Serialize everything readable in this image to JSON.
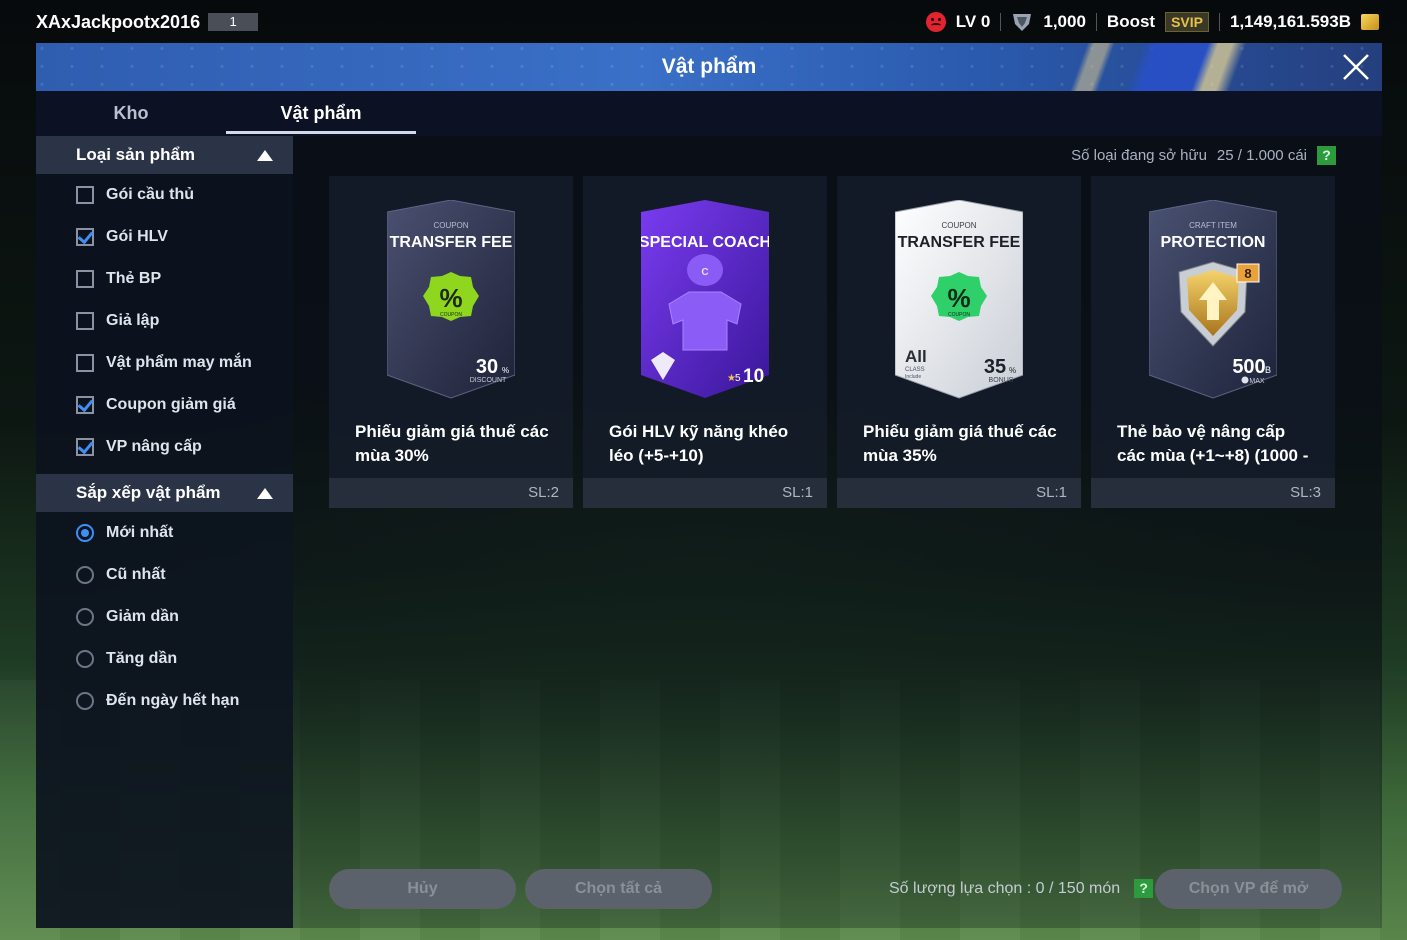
{
  "user": {
    "name": "XAxJackpootx2016",
    "level_box": "1"
  },
  "status": {
    "lv": "LV 0",
    "shield_count": "1,000",
    "boost_label": "Boost",
    "svip_label": "SVIP",
    "balance": "1,149,161.593B"
  },
  "modal": {
    "title": "Vật phẩm"
  },
  "tabs": [
    {
      "label": "Kho"
    },
    {
      "label": "Vật phẩm"
    }
  ],
  "sidebar": {
    "filter_title": "Loại sản phẩm",
    "filters": [
      {
        "label": "Gói cầu thủ",
        "checked": false
      },
      {
        "label": "Gói HLV",
        "checked": true
      },
      {
        "label": "Thẻ BP",
        "checked": false
      },
      {
        "label": "Giả lập",
        "checked": false
      },
      {
        "label": "Vật phẩm may mắn",
        "checked": false
      },
      {
        "label": "Coupon giảm giá",
        "checked": true
      },
      {
        "label": "VP nâng cấp",
        "checked": true
      }
    ],
    "sort_title": "Sắp xếp vật phẩm",
    "sorts": [
      {
        "label": "Mới nhất",
        "selected": true
      },
      {
        "label": "Cũ nhất",
        "selected": false
      },
      {
        "label": "Giảm dần",
        "selected": false
      },
      {
        "label": "Tăng dần",
        "selected": false
      },
      {
        "label": "Đến ngày hết hạn",
        "selected": false
      }
    ]
  },
  "owned": {
    "label": "Số loại đang sở hữu",
    "value": "25 / 1.000 cái"
  },
  "cards": [
    {
      "name": "Phiếu giảm giá thuế các mùa 30%",
      "qty": "SL:2",
      "art": {
        "kind": "coupon-dark",
        "top": "COUPON",
        "title": "TRANSFER FEE",
        "badge": "%",
        "badge_sub": "COUPON",
        "big": "30",
        "unit": "%",
        "sub": "DISCOUNT"
      }
    },
    {
      "name": "Gói HLV kỹ năng khéo léo (+5-+10)",
      "qty": "SL:1",
      "art": {
        "kind": "coach",
        "title": "SPECIAL COACH",
        "jersey": "C",
        "star_small": "5",
        "range": "10"
      }
    },
    {
      "name": "Phiếu giảm giá thuế các mùa 35%",
      "qty": "SL:1",
      "art": {
        "kind": "coupon-light",
        "top": "COUPON",
        "title": "TRANSFER FEE",
        "badge": "%",
        "badge_sub": "COUPON",
        "all": "All",
        "class": "CLASS",
        "include": "Include",
        "big": "35",
        "unit": "%",
        "sub": "BONUS"
      }
    },
    {
      "name": "Thẻ bảo vệ nâng cấp các mùa (+1~+8) (1000 -",
      "qty": "SL:3",
      "art": {
        "kind": "protection",
        "top": "CRAFT ITEM",
        "title": "PROTECTION",
        "level": "8",
        "big": "500",
        "unit": "B",
        "sub": "MAX"
      }
    }
  ],
  "footer": {
    "cancel": "Hủy",
    "select_all": "Chọn tất cả",
    "selection_label": "Số lượng lựa chọn : 0 / 150 món",
    "help": "?",
    "open": "Chọn VP để mở"
  },
  "colors": {
    "accent_blue": "#3d8ff5",
    "help_green": "#2e9a3e",
    "svip_gold": "#e7c14a",
    "badge_green": "#8fd61f"
  }
}
